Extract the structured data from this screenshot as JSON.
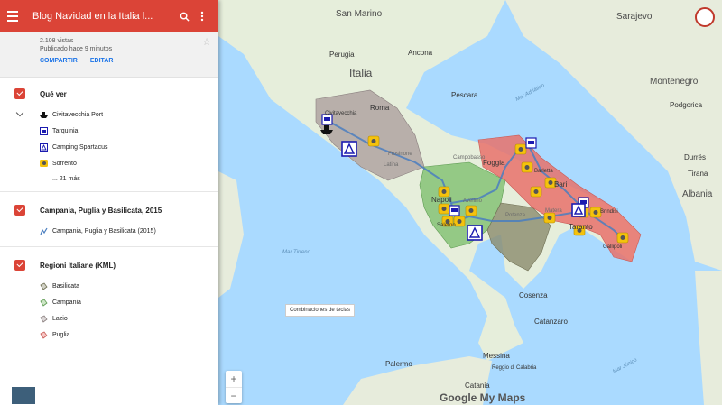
{
  "header": {
    "title": "Blog Navidad en la Italia l...",
    "menu_icon": "hamburger-menu-icon",
    "search_icon": "search-icon",
    "more_icon": "more-vert-icon"
  },
  "info": {
    "views": "2.108 vistas",
    "published": "Publicado hace 9 minutos",
    "share_label": "COMPARTIR",
    "edit_label": "EDITAR"
  },
  "layers": [
    {
      "title": "Qué ver",
      "items": [
        {
          "label": "Civitavecchia Port",
          "icon": "ship-icon"
        },
        {
          "label": "Tarquinia",
          "icon": "camper-van-icon"
        },
        {
          "label": "Camping Spartacus",
          "icon": "camping-tent-icon"
        },
        {
          "label": "Sorrento",
          "icon": "camera-icon"
        }
      ],
      "more": "... 21 más"
    },
    {
      "title": "Campania, Puglia y Basilicata, 2015",
      "items": [
        {
          "label": "Campania, Puglia y Basilicata (2015)",
          "icon": "route-line-icon"
        }
      ]
    },
    {
      "title": "Regioni Italiane (KML)",
      "items": [
        {
          "label": "Basilicata",
          "icon": "polygon-icon"
        },
        {
          "label": "Campania",
          "icon": "polygon-icon"
        },
        {
          "label": "Lazio",
          "icon": "polygon-icon"
        },
        {
          "label": "Puglia",
          "icon": "polygon-icon"
        }
      ]
    }
  ],
  "map": {
    "labels": {
      "san_marino": "San Marino",
      "sarajevo": "Sarajevo",
      "italia": "Italia",
      "montenegro": "Montenegro",
      "mar_adriatico": "Mar Adriático",
      "mar_tirreno": "Mar Tirreno",
      "mar_jonio": "Mar Jónico",
      "albania": "Albania",
      "tirana": "Tirana",
      "civitavecchia": "Civitavecchia",
      "napoli": "Napoli",
      "salerno": "Salerno",
      "bari": "Bari",
      "foggia": "Foggia",
      "barletta": "Barletta",
      "taranto": "Taranto",
      "brindisi": "Brindisi",
      "gallipoli": "Gallipoli",
      "potenza": "Potenza",
      "matera": "Matera",
      "cosenza": "Cosenza",
      "catanzaro": "Catanzaro",
      "palermo": "Palermo",
      "messina": "Messina",
      "reggio": "Reggio di Calabria",
      "catania": "Catania",
      "pescara": "Pescara",
      "campobasso": "Campobasso",
      "avellino": "Avellino",
      "latina": "Latina",
      "frosinone": "Frosinone",
      "roma": "Roma",
      "podgorica": "Podgorica",
      "durres": "Durrës",
      "ancona": "Ancona",
      "perugia": "Perugia"
    },
    "tooltip": "Combinaciones de teclas",
    "zoom_in": "+",
    "zoom_out": "−",
    "logo": "Google My Maps",
    "colors": {
      "lazio": "#a89a9a",
      "campania": "#7fbf6f",
      "basilicata": "#8b8b6d",
      "puglia": "#e8716b",
      "route": "#4a7ebf",
      "marker_camera": "#f4c20d",
      "marker_blue": "#1b1bb0"
    }
  }
}
